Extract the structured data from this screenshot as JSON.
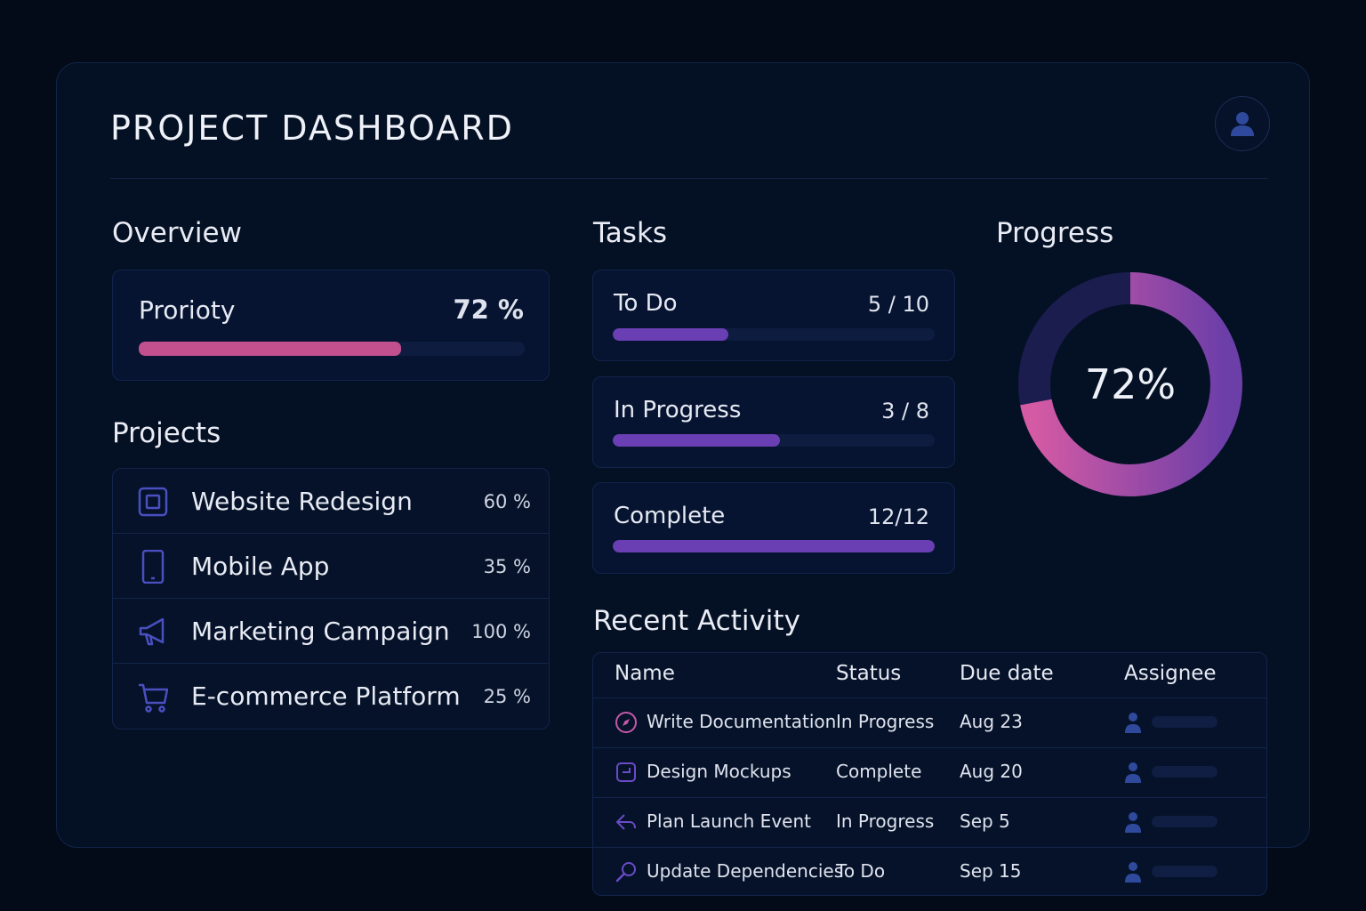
{
  "header": {
    "title": "PROJECT DASHBOARD",
    "avatar_icon": "user-icon"
  },
  "overview": {
    "title": "Overview",
    "priority_label": "Prorioty",
    "priority_value": "72 %",
    "priority_fraction": 0.68,
    "bar_color": "#c2508f"
  },
  "projects": {
    "title": "Projects",
    "items": [
      {
        "name": "Website Redesign",
        "percent": "60 %",
        "icon": "square-icon"
      },
      {
        "name": "Mobile App",
        "percent": "35 %",
        "icon": "phone-icon"
      },
      {
        "name": "Marketing Campaign",
        "percent": "100 %",
        "icon": "megaphone-icon"
      },
      {
        "name": "E-commerce Platform",
        "percent": "25 %",
        "icon": "cart-icon"
      }
    ]
  },
  "tasks": {
    "title": "Tasks",
    "items": [
      {
        "label": "To Do",
        "count": "5 / 10",
        "fraction": 0.36
      },
      {
        "label": "In Progress",
        "count": "3 / 8",
        "fraction": 0.52
      },
      {
        "label": "Complete",
        "count": "12/12",
        "fraction": 1.0
      }
    ],
    "bar_color": "#6a3fb3"
  },
  "progress": {
    "title": "Progress",
    "value_label": "72%",
    "fraction": 0.72,
    "accent_start": "#d45aa4",
    "accent_end": "#6b3ea8",
    "track_color": "#1a1d4e"
  },
  "activity": {
    "title": "Recent Activity",
    "columns": {
      "name": "Name",
      "status": "Status",
      "due": "Due date",
      "assignee": "Assignee"
    },
    "rows": [
      {
        "name": "Write Documentation",
        "status": "In Progress",
        "due": "Aug 23",
        "icon": "compass-icon"
      },
      {
        "name": "Design Mockups",
        "status": "Complete",
        "due": "Aug 20",
        "icon": "frame-icon"
      },
      {
        "name": "Plan Launch Event",
        "status": "In Progress",
        "due": "Sep 5",
        "icon": "reply-arrow-icon"
      },
      {
        "name": "Update Dependencies",
        "status": "To Do",
        "due": "Sep 15",
        "icon": "wrench-icon"
      }
    ]
  }
}
